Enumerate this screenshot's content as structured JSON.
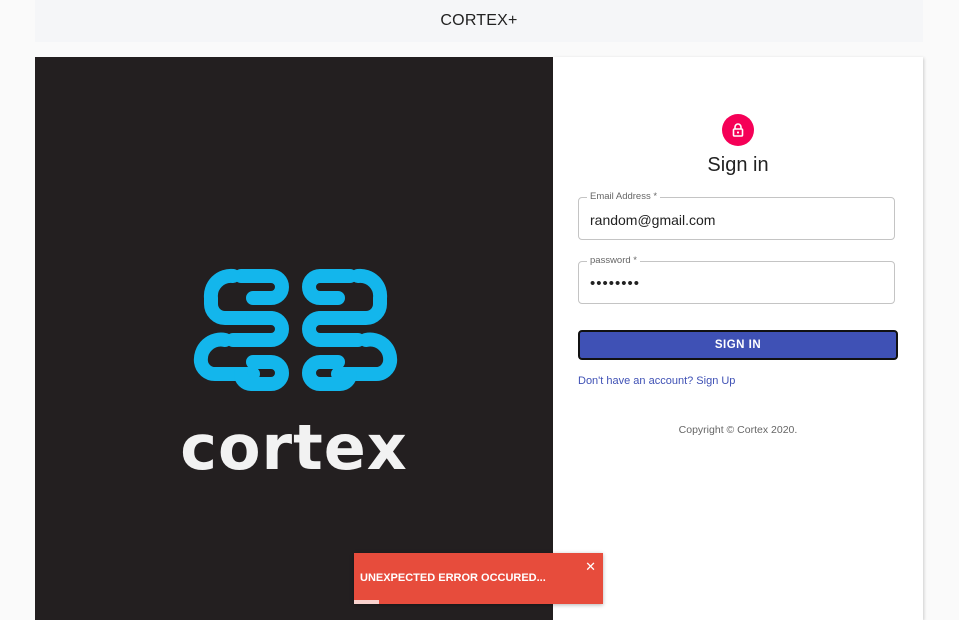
{
  "header": {
    "title": "CORTEX+"
  },
  "brand": {
    "wordmark": "cortex",
    "logo_icon": "brain-icon",
    "logo_color": "#13b6ec",
    "panel_bg": "#231f20"
  },
  "form": {
    "title": "Sign in",
    "avatar_icon": "lock-icon",
    "avatar_color": "#f50057",
    "email": {
      "label": "Email Address *",
      "value": "random@gmail.com"
    },
    "password": {
      "label": "password *",
      "value": "••••••••"
    },
    "submit_label": "SIGN IN",
    "submit_color": "#3f51b5",
    "signup_link": "Don't have an account? Sign Up",
    "copyright": "Copyright © Cortex 2020."
  },
  "toast": {
    "message": "UNEXPECTED ERROR OCCURED...",
    "close_glyph": "✕",
    "color": "#e74c3c",
    "progress": 0.1
  }
}
